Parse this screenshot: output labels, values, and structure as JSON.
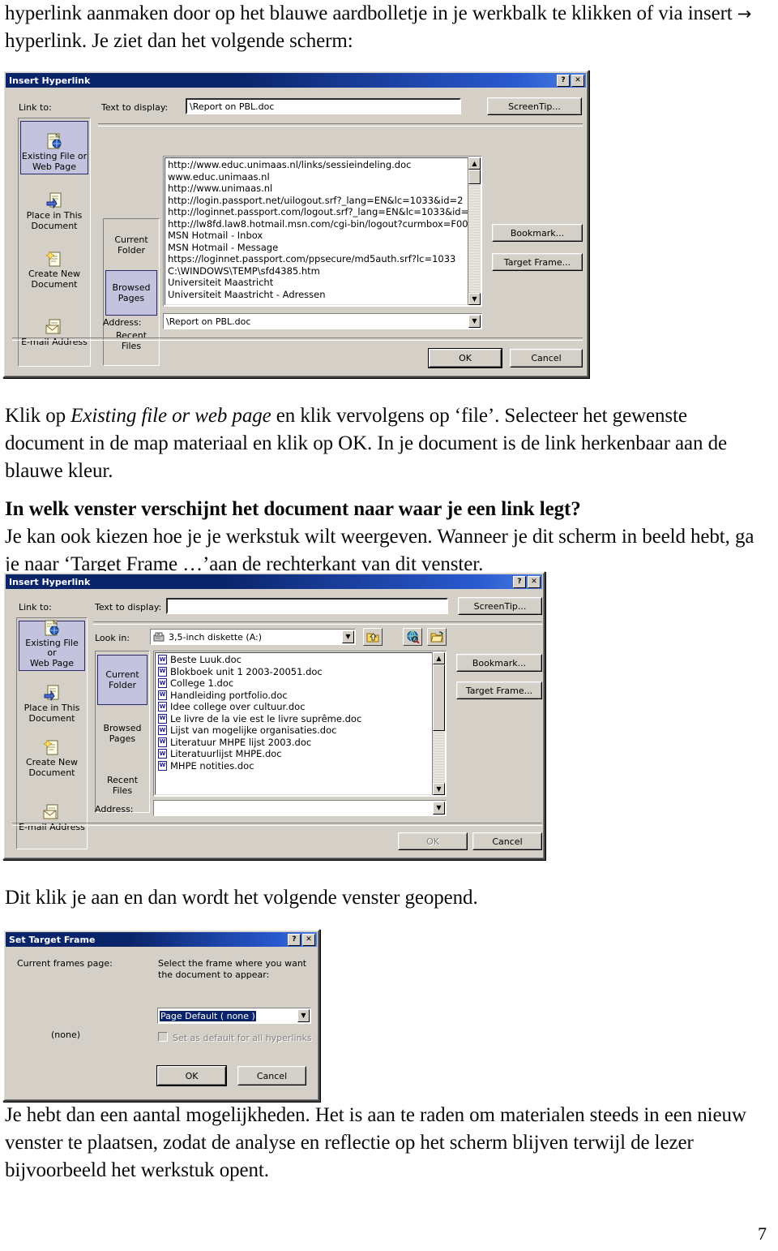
{
  "document": {
    "page_number": "7",
    "paragraphs": {
      "intro_line1": "hyperlink aanmaken door op het blauwe aardbolletje in je werkbalk te klikken of via insert ",
      "intro_arrow": "→",
      "intro_line2": "hyperlink. Je ziet dan het volgende scherm:",
      "p2_a": "Klik op ",
      "p2_em": "Existing file or web page",
      "p2_b": " en klik vervolgens op ‘file’. Selecteer het gewenste document in de map materiaal en klik op OK. In je document is de link herkenbaar aan de blauwe kleur.",
      "p3_heading": "In welk venster verschijnt het document naar waar je een link legt?",
      "p3_body": "Je kan ook kiezen hoe je je werkstuk wilt weergeven. Wanneer je dit scherm in beeld hebt, ga je naar ‘Target Frame …’aan de rechterkant van dit venster.",
      "p4": "Dit klik je aan en dan wordt het volgende venster geopend.",
      "p5": "Je hebt dan een aantal mogelijkheden. Het is aan te raden om materialen steeds in een nieuw venster te plaatsen, zodat de analyse en reflectie op het scherm blijven terwijl de lezer bijvoorbeeld het werkstuk opent."
    }
  },
  "dialog1": {
    "title": "Insert Hyperlink",
    "help_button": "?",
    "close_button": "✕",
    "link_to_label": "Link to:",
    "text_to_display_label": "Text to display:",
    "text_to_display_value": "\\Report on PBL.doc",
    "screentip_button": "ScreenTip...",
    "bookmark_button": "Bookmark...",
    "target_frame_button": "Target Frame...",
    "ok_button": "OK",
    "cancel_button": "Cancel",
    "address_label": "Address:",
    "address_value": "\\Report on PBL.doc",
    "nav_items": [
      {
        "label1": "Existing File or",
        "label2": "Web Page",
        "icon": "existing-file-icon",
        "selected": true
      },
      {
        "label1": "Place in This",
        "label2": "Document",
        "icon": "place-in-document-icon",
        "selected": false
      },
      {
        "label1": "Create New",
        "label2": "Document",
        "icon": "create-new-document-icon",
        "selected": false
      },
      {
        "label1": "E-mail Address",
        "label2": "",
        "icon": "email-address-icon",
        "selected": false
      }
    ],
    "tabs": [
      {
        "label1": "Current",
        "label2": "Folder",
        "selected": false
      },
      {
        "label1": "Browsed",
        "label2": "Pages",
        "selected": true
      },
      {
        "label1": "Recent",
        "label2": "Files",
        "selected": false
      }
    ],
    "toolbar_icons": [
      "browse-web-icon",
      "browse-file-icon"
    ],
    "list_items": [
      "http://www.educ.unimaas.nl/links/sessieindeling.doc",
      "www.educ.unimaas.nl",
      "http://www.unimaas.nl",
      "http://login.passport.net/uilogout.srf?_lang=EN&lc=1033&id=2",
      "http://loginnet.passport.com/logout.srf?_lang=EN&lc=1033&id=",
      "http://lw8fd.law8.hotmail.msn.com/cgi-bin/logout?curmbox=F00",
      "MSN Hotmail - Inbox",
      "MSN Hotmail - Message",
      "https://loginnet.passport.com/ppsecure/md5auth.srf?lc=1033",
      "C:\\WINDOWS\\TEMP\\sfd4385.htm",
      "Universiteit Maastricht",
      "Universiteit Maastricht - Adressen"
    ]
  },
  "dialog2": {
    "title": "Insert Hyperlink",
    "help_button": "?",
    "close_button": "✕",
    "link_to_label": "Link to:",
    "text_to_display_label": "Text to display:",
    "text_to_display_value": "",
    "look_in_label": "Look in:",
    "look_in_value": "3,5-inch diskette (A:)",
    "screentip_button": "ScreenTip...",
    "bookmark_button": "Bookmark...",
    "target_frame_button": "Target Frame...",
    "ok_button": "OK",
    "ok_disabled": true,
    "cancel_button": "Cancel",
    "address_label": "Address:",
    "address_value": "",
    "nav_items": [
      {
        "label1": "Existing File or",
        "label2": "Web Page",
        "icon": "existing-file-icon",
        "selected": true
      },
      {
        "label1": "Place in This",
        "label2": "Document",
        "icon": "place-in-document-icon",
        "selected": false
      },
      {
        "label1": "Create New",
        "label2": "Document",
        "icon": "create-new-document-icon",
        "selected": false
      },
      {
        "label1": "E-mail Address",
        "label2": "",
        "icon": "email-address-icon",
        "selected": false
      }
    ],
    "tabs": [
      {
        "label1": "Current",
        "label2": "Folder",
        "selected": true
      },
      {
        "label1": "Browsed",
        "label2": "Pages",
        "selected": false
      },
      {
        "label1": "Recent",
        "label2": "Files",
        "selected": false
      }
    ],
    "toolbar_icons": [
      "up-one-level-icon",
      "browse-web-icon",
      "browse-file-icon"
    ],
    "file_items": [
      "Beste Luuk.doc",
      "Blokboek unit 1 2003-20051.doc",
      "College 1.doc",
      "Handleiding portfolio.doc",
      "Idee college over cultuur.doc",
      "Le livre de la vie est le livre suprême.doc",
      "Lijst van mogelijke organisaties.doc",
      "Literatuur MHPE lijst 2003.doc",
      "Literatuurlijst MHPE.doc",
      "MHPE notities.doc"
    ]
  },
  "dialog3": {
    "title": "Set Target Frame",
    "help_button": "?",
    "close_button": "✕",
    "current_frames_label": "Current frames page:",
    "current_frames_value": "(none)",
    "select_frame_label_line1": "Select the frame where you want",
    "select_frame_label_line2": "the document to appear:",
    "frame_combo_value": "Page Default ( none )",
    "checkbox_label": "Set as default for all hyperlinks",
    "checkbox_checked": false,
    "checkbox_disabled": true,
    "ok_button": "OK",
    "cancel_button": "Cancel"
  },
  "colors": {
    "titlebar_start": "#0a246a",
    "titlebar_end": "#4a7fe0",
    "dialog_face": "#d4d0c8",
    "selection": "#c3c3dd",
    "selection_border": "#28286e",
    "highlight": "#0a246a"
  }
}
